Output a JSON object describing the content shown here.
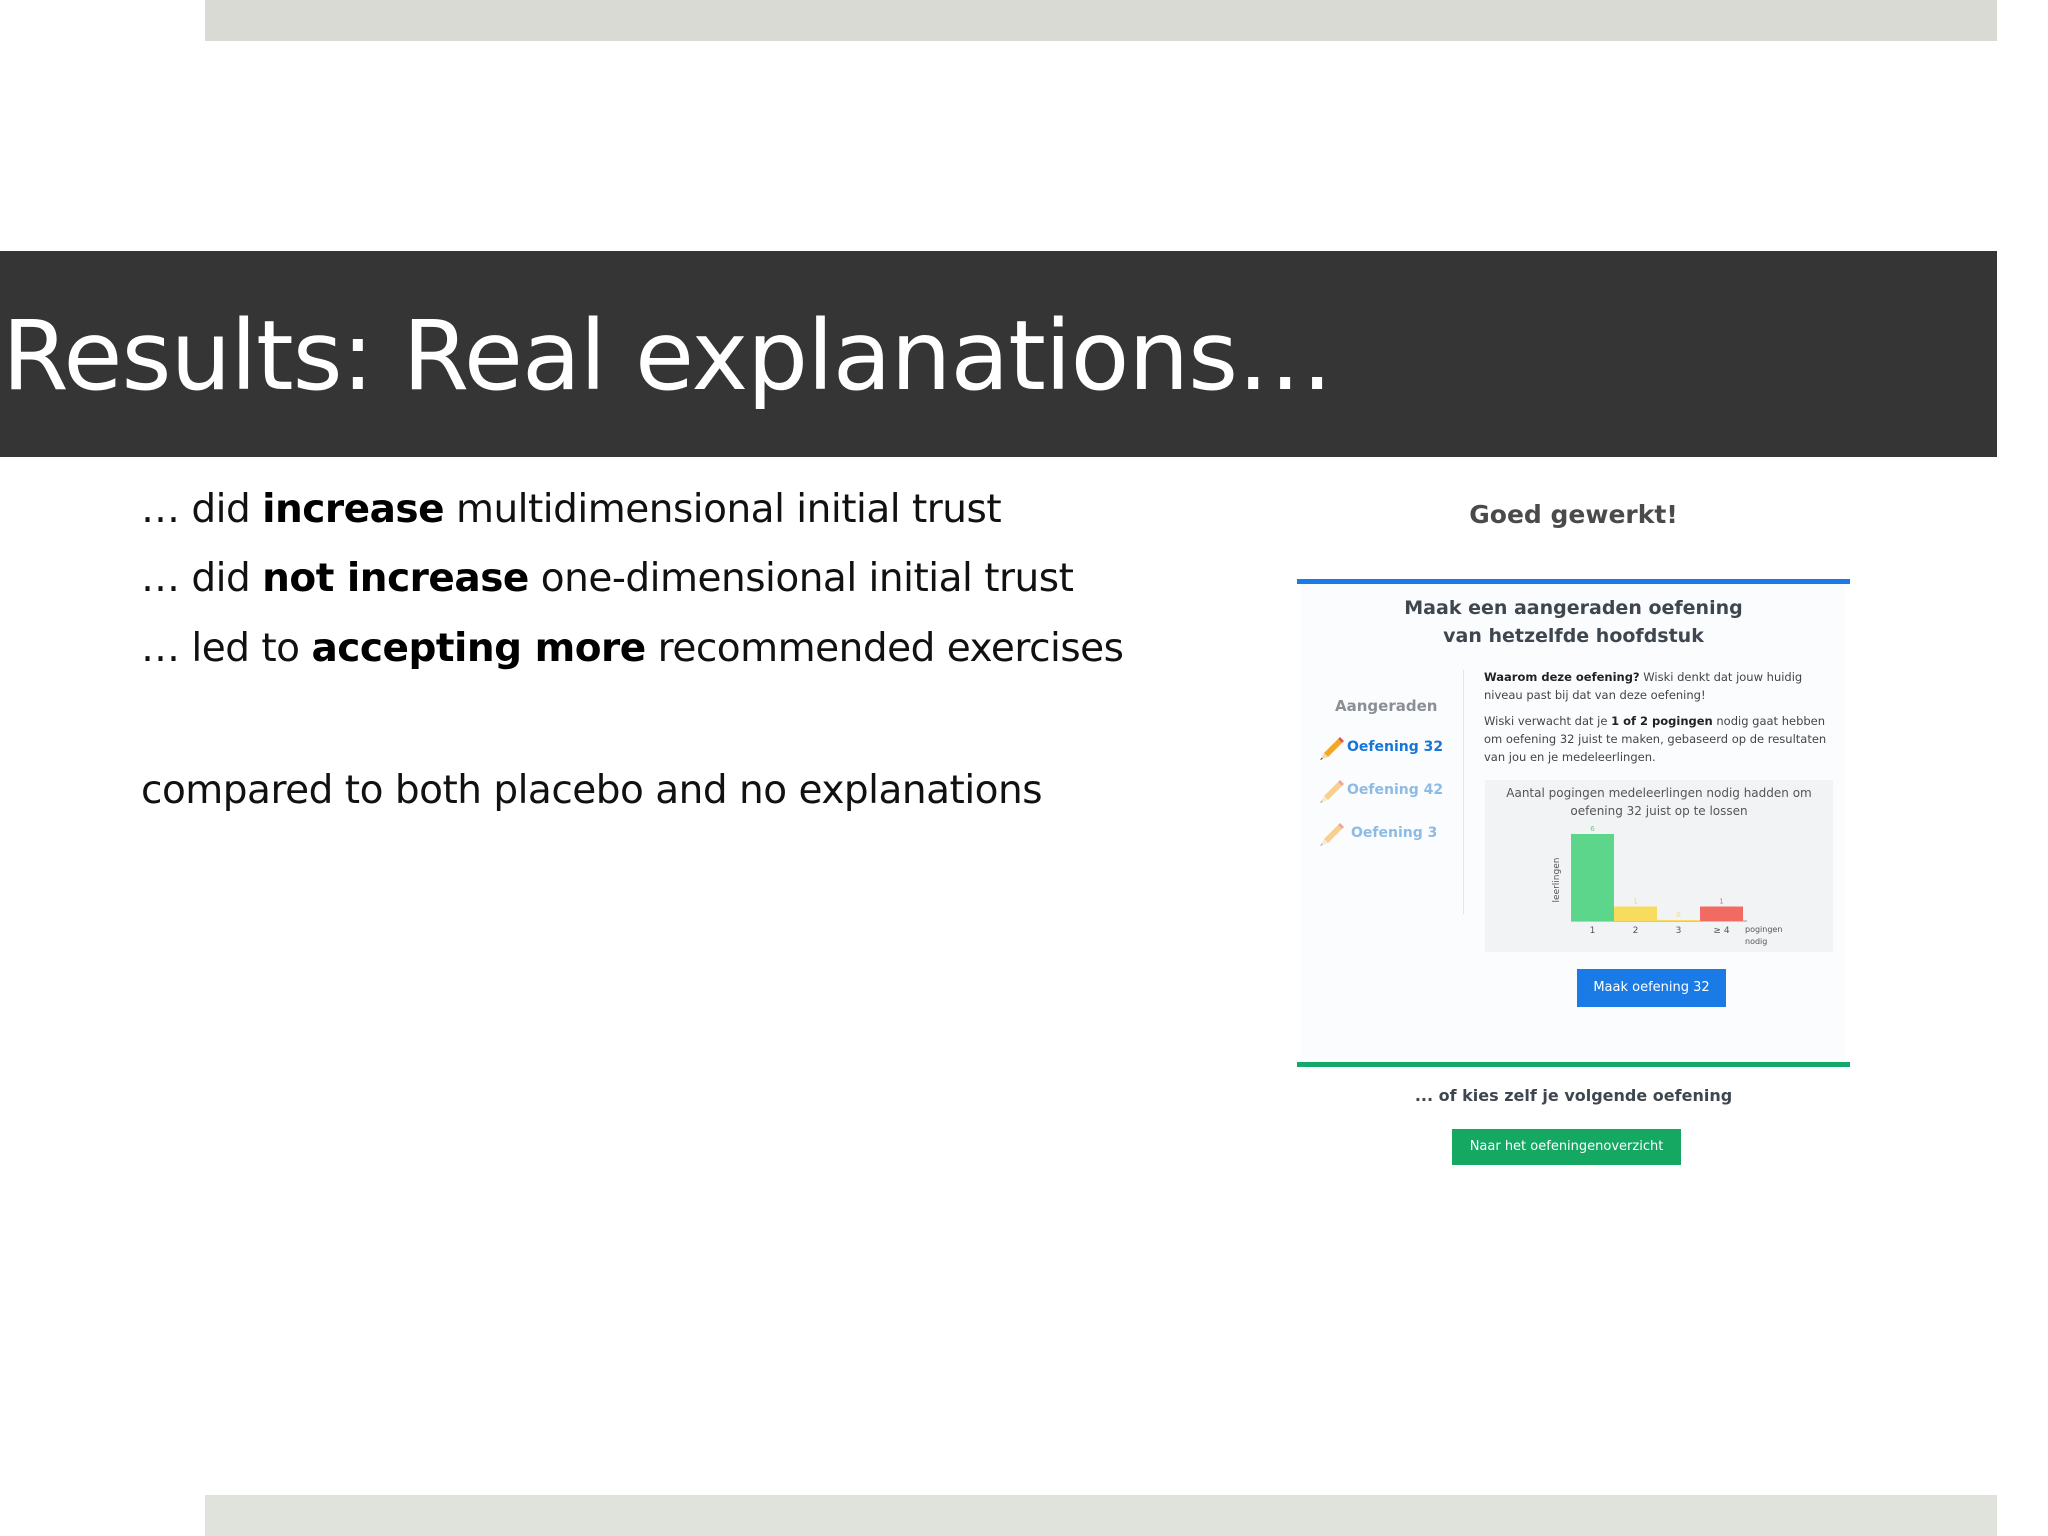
{
  "slide": {
    "title": "Results: Real explanations…",
    "bullets": [
      {
        "prefix": "… did ",
        "bold": "increase",
        "suffix": " multidimensional initial trust"
      },
      {
        "prefix": "… did ",
        "bold": "not increase",
        "suffix": " one-dimensional initial trust"
      },
      {
        "prefix": "… led to ",
        "bold": "accepting more",
        "suffix": " recommended exercises"
      }
    ],
    "comparison": "compared to both placebo and no explanations"
  },
  "screenshot": {
    "heading": "Goed gewerkt!",
    "recommend_heading_line1": "Maak een aangeraden oefening",
    "recommend_heading_line2": "van hetzelfde hoofdstuk",
    "sidebar_title": "Aangeraden",
    "exercises": [
      "Oefening 32",
      "Oefening 42",
      "Oefening 3"
    ],
    "why_bold": "Waarom deze oefening?",
    "why_text": " Wiski denkt dat jouw huidig niveau past bij dat van deze oefening!",
    "expect_prefix": "Wiski verwacht dat je ",
    "expect_bold": "1 of 2 pogingen",
    "expect_suffix": " nodig gaat hebben om oefening 32 juist te maken, gebaseerd op de resultaten van jou en je medeleerlingen.",
    "chart_title": "Aantal pogingen medeleerlingen nodig hadden om oefening 32 juist op te lossen",
    "make_button": "Maak oefening 32",
    "choose_text": "... of kies zelf je volgende oefening",
    "overview_button": "Naar het oefeningenoverzicht",
    "colors": {
      "blue": "#1a7be6",
      "green": "#14a863"
    }
  },
  "chart_data": {
    "type": "bar",
    "categories": [
      "1",
      "2",
      "3",
      "≥ 4"
    ],
    "values": [
      6,
      1,
      0,
      1
    ],
    "colors": [
      "#5cd68b",
      "#f7dc5e",
      "#f7dc5e",
      "#f26b63"
    ],
    "title": "Aantal pogingen medeleerlingen nodig hadden om oefening 32 juist op te lossen",
    "xlabel": "pogingen nodig",
    "ylabel": "leerlingen",
    "ylim": [
      0,
      6
    ]
  }
}
